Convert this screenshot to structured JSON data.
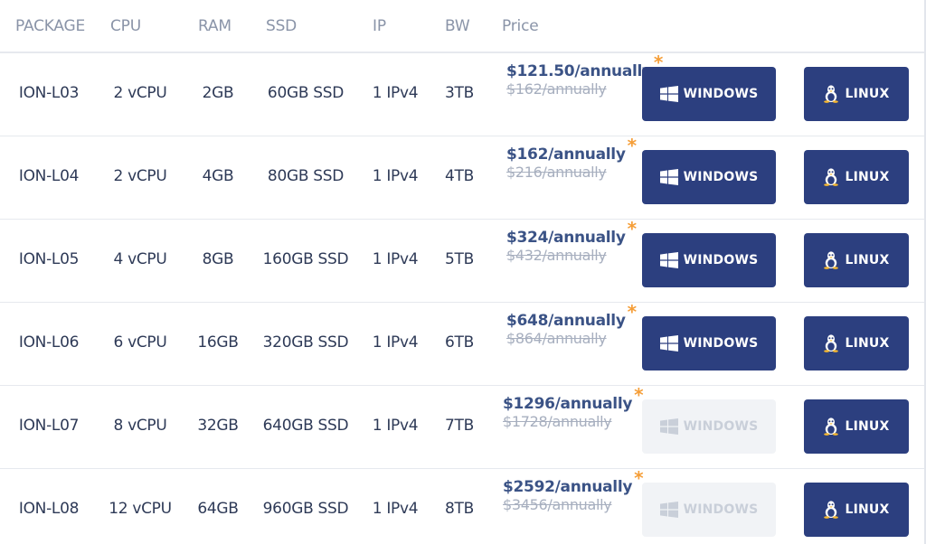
{
  "headers": {
    "package": "PACKAGE",
    "cpu": "CPU",
    "ram": "RAM",
    "ssd": "SSD",
    "ip": "IP",
    "bw": "BW",
    "price": "Price"
  },
  "buttons": {
    "windows_label": "WINDOWS",
    "linux_label": "LINUX"
  },
  "star": "*",
  "colors": {
    "primary_button": "#2c3f7f",
    "disabled_button": "#f1f3f6",
    "price_text": "#3b5386",
    "star": "#f59e38"
  },
  "icons": {
    "windows": "windows-logo-icon",
    "linux": "linux-tux-icon"
  },
  "packages": [
    {
      "name": "ION-L03",
      "cpu": "2 vCPU",
      "ram": "2GB",
      "ssd": "60GB SSD",
      "ip": "1 IPv4",
      "bw": "3TB",
      "price": "$121.50/annually",
      "old_price": "$162/annually",
      "windows_enabled": true
    },
    {
      "name": "ION-L04",
      "cpu": "2 vCPU",
      "ram": "4GB",
      "ssd": "80GB SSD",
      "ip": "1 IPv4",
      "bw": "4TB",
      "price": "$162/annually",
      "old_price": "$216/annually",
      "windows_enabled": true
    },
    {
      "name": "ION-L05",
      "cpu": "4 vCPU",
      "ram": "8GB",
      "ssd": "160GB SSD",
      "ip": "1 IPv4",
      "bw": "5TB",
      "price": "$324/annually",
      "old_price": "$432/annually",
      "windows_enabled": true
    },
    {
      "name": "ION-L06",
      "cpu": "6 vCPU",
      "ram": "16GB",
      "ssd": "320GB SSD",
      "ip": "1 IPv4",
      "bw": "6TB",
      "price": "$648/annually",
      "old_price": "$864/annually",
      "windows_enabled": true
    },
    {
      "name": "ION-L07",
      "cpu": "8 vCPU",
      "ram": "32GB",
      "ssd": "640GB SSD",
      "ip": "1 IPv4",
      "bw": "7TB",
      "price": "$1296/annually",
      "old_price": "$1728/annually",
      "windows_enabled": false
    },
    {
      "name": "ION-L08",
      "cpu": "12 vCPU",
      "ram": "64GB",
      "ssd": "960GB SSD",
      "ip": "1 IPv4",
      "bw": "8TB",
      "price": "$2592/annually",
      "old_price": "$3456/annually",
      "windows_enabled": false
    }
  ]
}
